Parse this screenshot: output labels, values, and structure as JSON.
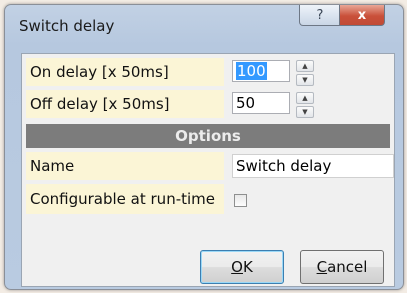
{
  "window": {
    "title": "Switch delay",
    "help_label": "?",
    "close_label": "x"
  },
  "fields": {
    "on_delay": {
      "label": "On delay [x 50ms]",
      "value": "100"
    },
    "off_delay": {
      "label": "Off delay [x 50ms]",
      "value": "50"
    }
  },
  "options": {
    "header": "Options",
    "name": {
      "label": "Name",
      "value": "Switch delay"
    },
    "configurable": {
      "label": "Configurable at run-time",
      "checked": false
    }
  },
  "buttons": {
    "ok": {
      "mnemonic": "O",
      "rest": "K"
    },
    "cancel": {
      "mnemonic": "C",
      "rest": "ancel"
    }
  },
  "icons": {
    "spin_up": "spin-up-icon",
    "spin_down": "spin-down-icon"
  }
}
